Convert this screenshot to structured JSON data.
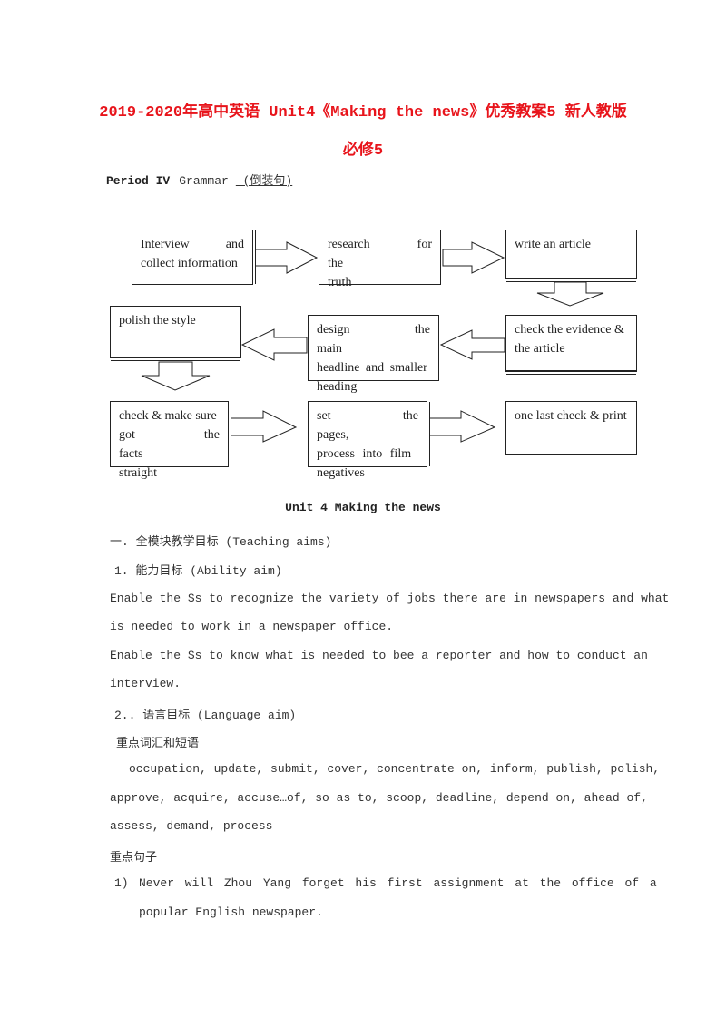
{
  "header": {
    "title_line1": "2019-2020年高中英语 Unit4《Making the news》优秀教案5 新人教版",
    "title_line2": "必修5",
    "title_color": "#e8141b",
    "period_label": "Period IV",
    "period_topic": "Grammar",
    "period_note": " (倒装句)"
  },
  "flowchart": {
    "steps": [
      {
        "id": 1,
        "lines": [
          "Interview and",
          "collect information"
        ]
      },
      {
        "id": 2,
        "lines": [
          "research for the",
          "truth"
        ]
      },
      {
        "id": 3,
        "lines": [
          "write an article"
        ]
      },
      {
        "id": 4,
        "lines": [
          "check the evidence &",
          "the article"
        ]
      },
      {
        "id": 5,
        "lines": [
          "design the main",
          "headline and smaller",
          "heading"
        ]
      },
      {
        "id": 6,
        "lines": [
          "polish the style"
        ]
      },
      {
        "id": 7,
        "lines": [
          "check & make sure",
          "got the facts",
          "straight"
        ]
      },
      {
        "id": 8,
        "lines": [
          "set the pages,",
          "process into film",
          "negatives"
        ]
      },
      {
        "id": 9,
        "lines": [
          "one last check & print"
        ]
      }
    ],
    "flow_order": [
      1,
      2,
      3,
      4,
      5,
      6,
      7,
      8,
      9
    ]
  },
  "content": {
    "unit_heading": "Unit 4 Making the news",
    "section1": "一. 全模块教学目标 (Teaching aims)",
    "sub1": "1. 能力目标 (Ability aim)",
    "ability_lines": [
      "Enable the Ss to recognize the variety of jobs there are in newspapers and what",
      "is needed to work in a newspaper office.",
      "Enable the Ss to know what is needed to bee a reporter and how to conduct an",
      "interview."
    ],
    "sub2": "2.. 语言目标 (Language aim)",
    "vocab_heading": "重点词汇和短语",
    "vocab_lines": [
      "occupation, update, submit, cover, concentrate on, inform, publish, polish,",
      "approve, acquire, accuse…of, so as to, scoop, deadline, depend on, ahead of,",
      "assess, demand, process"
    ],
    "sentence_heading": "重点句子",
    "sentences": [
      {
        "num": "1)",
        "lines": [
          "Never will Zhou Yang forget his first assignment at the office of a",
          "popular English newspaper."
        ]
      }
    ]
  }
}
